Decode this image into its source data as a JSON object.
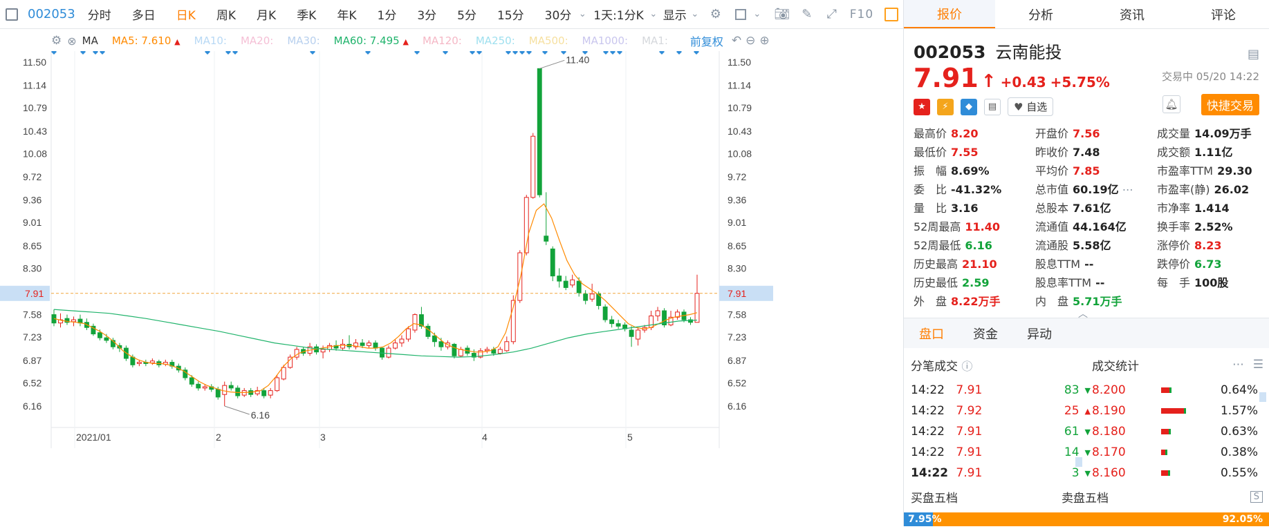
{
  "toolbar": {
    "code": "002053",
    "periods": [
      "分时",
      "多日",
      "日K",
      "周K",
      "月K",
      "季K",
      "年K",
      "1分",
      "3分",
      "5分",
      "15分",
      "30分"
    ],
    "active_period": "日K",
    "combo": "1天:1分K",
    "display": "显示",
    "f10": "F10"
  },
  "ma_bar": {
    "ma_label": "MA",
    "ma5": "MA5: 7.610",
    "ma10": "MA10:",
    "ma20": "MA20:",
    "ma30": "MA30:",
    "ma60": "MA60: 7.495",
    "ma120": "MA120:",
    "ma250": "MA250:",
    "ma500": "MA500:",
    "ma1000": "MA1000:",
    "ma1": "MA1:",
    "adjust": "前复权"
  },
  "colors": {
    "up": "#e5211c",
    "down": "#12a33a",
    "ma5": "#ff8a00",
    "ma60": "#1fb36b",
    "accent": "#ff7e00",
    "blue": "#2f8cd8"
  },
  "chart_data": {
    "type": "candlestick",
    "y_ticks": [
      "11.50",
      "11.14",
      "10.79",
      "10.43",
      "10.08",
      "9.72",
      "9.36",
      "9.01",
      "8.65",
      "8.30",
      "7.91",
      "7.58",
      "7.23",
      "6.87",
      "6.52",
      "6.16"
    ],
    "x_ticks": [
      "2021/01",
      "2",
      "3",
      "4",
      "5"
    ],
    "current_price": "7.91",
    "high_label": "11.40",
    "low_label": "6.16",
    "ylim": [
      5.9,
      11.75
    ],
    "candles": [
      [
        7.58,
        7.45,
        7.66,
        7.4
      ],
      [
        7.45,
        7.5,
        7.6,
        7.38
      ],
      [
        7.52,
        7.46,
        7.58,
        7.42
      ],
      [
        7.47,
        7.5,
        7.55,
        7.4
      ],
      [
        7.51,
        7.45,
        7.58,
        7.4
      ],
      [
        7.46,
        7.38,
        7.52,
        7.34
      ],
      [
        7.4,
        7.28,
        7.44,
        7.25
      ],
      [
        7.3,
        7.22,
        7.35,
        7.18
      ],
      [
        7.22,
        7.18,
        7.28,
        7.14
      ],
      [
        7.18,
        7.08,
        7.22,
        7.04
      ],
      [
        7.1,
        7.06,
        7.14,
        7.0
      ],
      [
        7.06,
        6.9,
        7.1,
        6.86
      ],
      [
        6.92,
        6.8,
        6.96,
        6.76
      ],
      [
        6.82,
        6.84,
        6.88,
        6.78
      ],
      [
        6.84,
        6.82,
        6.88,
        6.78
      ],
      [
        6.83,
        6.86,
        6.9,
        6.8
      ],
      [
        6.85,
        6.8,
        6.88,
        6.76
      ],
      [
        6.81,
        6.84,
        6.88,
        6.78
      ],
      [
        6.84,
        6.78,
        6.88,
        6.74
      ],
      [
        6.78,
        6.72,
        6.82,
        6.68
      ],
      [
        6.72,
        6.6,
        6.76,
        6.56
      ],
      [
        6.6,
        6.5,
        6.64,
        6.46
      ],
      [
        6.5,
        6.44,
        6.54,
        6.4
      ],
      [
        6.44,
        6.46,
        6.5,
        6.4
      ],
      [
        6.46,
        6.42,
        6.5,
        6.38
      ],
      [
        6.42,
        6.3,
        6.46,
        6.26
      ],
      [
        6.34,
        6.48,
        6.54,
        6.16
      ],
      [
        6.48,
        6.44,
        6.54,
        6.4
      ],
      [
        6.44,
        6.32,
        6.48,
        6.28
      ],
      [
        6.33,
        6.4,
        6.44,
        6.3
      ],
      [
        6.4,
        6.34,
        6.44,
        6.3
      ],
      [
        6.35,
        6.4,
        6.46,
        6.32
      ],
      [
        6.4,
        6.32,
        6.44,
        6.28
      ],
      [
        6.33,
        6.4,
        6.44,
        6.28
      ],
      [
        6.4,
        6.6,
        6.64,
        6.38
      ],
      [
        6.58,
        6.76,
        6.8,
        6.56
      ],
      [
        6.76,
        6.92,
        6.96,
        6.74
      ],
      [
        6.92,
        7.04,
        7.08,
        6.88
      ],
      [
        7.04,
        6.98,
        7.08,
        6.94
      ],
      [
        6.98,
        7.08,
        7.14,
        6.94
      ],
      [
        7.08,
        7.0,
        7.12,
        6.96
      ],
      [
        7.0,
        7.04,
        7.1,
        6.9
      ],
      [
        7.04,
        7.1,
        7.14,
        7.0
      ],
      [
        7.1,
        7.06,
        7.18,
        7.02
      ],
      [
        7.06,
        7.12,
        7.2,
        7.02
      ],
      [
        7.12,
        7.08,
        7.26,
        7.04
      ],
      [
        7.08,
        7.14,
        7.2,
        7.04
      ],
      [
        7.14,
        7.1,
        7.2,
        7.06
      ],
      [
        7.1,
        7.14,
        7.18,
        7.06
      ],
      [
        7.14,
        7.06,
        7.18,
        7.02
      ],
      [
        7.06,
        6.92,
        7.08,
        6.88
      ],
      [
        6.92,
        7.06,
        7.1,
        6.9
      ],
      [
        7.06,
        7.14,
        7.2,
        7.04
      ],
      [
        7.14,
        7.2,
        7.26,
        7.08
      ],
      [
        7.2,
        7.36,
        7.4,
        7.16
      ],
      [
        7.34,
        7.58,
        7.6,
        7.3
      ],
      [
        7.58,
        7.4,
        7.7,
        7.36
      ],
      [
        7.4,
        7.24,
        7.44,
        7.2
      ],
      [
        7.25,
        7.16,
        7.3,
        7.08
      ],
      [
        7.16,
        7.08,
        7.22,
        7.02
      ],
      [
        7.08,
        7.14,
        7.18,
        7.04
      ],
      [
        7.12,
        6.94,
        7.14,
        6.9
      ],
      [
        6.94,
        7.04,
        7.08,
        6.92
      ],
      [
        7.06,
        6.98,
        7.1,
        6.94
      ],
      [
        6.98,
        6.92,
        7.04,
        6.86
      ],
      [
        6.92,
        7.02,
        7.06,
        6.9
      ],
      [
        7.02,
        7.04,
        7.08,
        6.98
      ],
      [
        7.04,
        6.98,
        7.08,
        6.94
      ],
      [
        6.98,
        7.04,
        7.08,
        6.96
      ],
      [
        7.02,
        7.16,
        7.24,
        7.0
      ],
      [
        7.16,
        7.8,
        7.88,
        7.12
      ],
      [
        7.8,
        8.54,
        8.58,
        7.76
      ],
      [
        8.54,
        9.4,
        9.44,
        8.5
      ],
      [
        9.4,
        10.35,
        10.4,
        9.38
      ],
      [
        11.4,
        9.44,
        11.4,
        9.4
      ],
      [
        8.8,
        8.72,
        9.48,
        8.66
      ],
      [
        8.6,
        8.18,
        8.64,
        8.1
      ],
      [
        8.18,
        8.1,
        8.3,
        8.0
      ],
      [
        8.1,
        8.0,
        8.18,
        7.96
      ],
      [
        8.04,
        8.12,
        8.2,
        8.0
      ],
      [
        8.1,
        7.92,
        8.16,
        7.86
      ],
      [
        7.9,
        7.8,
        7.96,
        7.74
      ],
      [
        7.82,
        7.9,
        8.06,
        7.78
      ],
      [
        7.9,
        7.72,
        7.94,
        7.66
      ],
      [
        7.7,
        7.5,
        7.74,
        7.46
      ],
      [
        7.5,
        7.44,
        7.56,
        7.38
      ],
      [
        7.44,
        7.4,
        7.5,
        7.36
      ],
      [
        7.42,
        7.36,
        7.46,
        7.32
      ],
      [
        7.34,
        7.24,
        7.4,
        7.08
      ],
      [
        7.2,
        7.34,
        7.38,
        7.1
      ],
      [
        7.34,
        7.38,
        7.42,
        7.3
      ],
      [
        7.38,
        7.56,
        7.64,
        7.34
      ],
      [
        7.56,
        7.64,
        7.7,
        7.48
      ],
      [
        7.64,
        7.42,
        7.68,
        7.38
      ],
      [
        7.42,
        7.54,
        7.64,
        7.4
      ],
      [
        7.54,
        7.62,
        7.66,
        7.5
      ],
      [
        7.62,
        7.5,
        7.66,
        7.46
      ],
      [
        7.5,
        7.46,
        7.54,
        7.42
      ],
      [
        7.46,
        7.91,
        8.2,
        7.55
      ]
    ],
    "ma5": [
      7.52,
      7.49,
      7.47,
      7.46,
      7.44,
      7.38,
      7.32,
      7.24,
      7.14,
      7.02,
      6.94,
      6.88,
      6.84,
      6.82,
      6.82,
      6.8,
      6.76,
      6.7,
      6.62,
      6.54,
      6.48,
      6.44,
      6.4,
      6.38,
      6.37,
      6.37,
      6.38,
      6.4,
      6.48,
      6.62,
      6.78,
      6.9,
      6.98,
      7.02,
      7.04,
      7.06,
      7.08,
      7.1,
      7.1,
      7.1,
      7.08,
      7.06,
      7.06,
      7.08,
      7.14,
      7.24,
      7.36,
      7.44,
      7.42,
      7.34,
      7.24,
      7.14,
      7.08,
      7.04,
      7.02,
      7.0,
      7.0,
      7.02,
      7.08,
      7.3,
      7.7,
      8.2,
      8.84,
      9.2,
      9.3,
      9.08,
      8.74,
      8.42,
      8.2,
      8.06,
      7.98,
      7.9,
      7.8,
      7.68,
      7.56,
      7.44,
      7.38,
      7.36,
      7.38,
      7.44,
      7.5,
      7.54,
      7.56,
      7.58,
      7.61
    ],
    "ma60": [
      7.66,
      7.64,
      7.62,
      7.6,
      7.56,
      7.52,
      7.47,
      7.42,
      7.37,
      7.32,
      7.26,
      7.2,
      7.14,
      7.1,
      7.06,
      7.04,
      7.02,
      7.0,
      6.98,
      6.96,
      6.94,
      6.93,
      6.92,
      6.93,
      6.96,
      7.0,
      7.06,
      7.14,
      7.22,
      7.28,
      7.32,
      7.36,
      7.4,
      7.44,
      7.48,
      7.495
    ]
  },
  "quote": {
    "code": "002053",
    "name": "云南能投",
    "price": "7.91",
    "arrow": "↑",
    "change": "+0.43",
    "change_pct": "+5.75%",
    "status": "交易中 05/20 14:22",
    "zixuan": "自选",
    "fast_trade": "快捷交易"
  },
  "right_tabs": [
    "报价",
    "分析",
    "资讯",
    "评论"
  ],
  "metrics": [
    {
      "label": "最高价",
      "value": "8.20",
      "color": "red"
    },
    {
      "label": "开盘价",
      "value": "7.56",
      "color": "red"
    },
    {
      "label": "成交量",
      "value": "14.09万手",
      "color": "dark"
    },
    {
      "label": "最低价",
      "value": "7.55",
      "color": "red"
    },
    {
      "label": "昨收价",
      "value": "7.48",
      "color": "dark"
    },
    {
      "label": "成交额",
      "value": "1.11亿",
      "color": "dark"
    },
    {
      "label": "振　幅",
      "value": "8.69%",
      "color": "dark"
    },
    {
      "label": "平均价",
      "value": "7.85",
      "color": "red"
    },
    {
      "label": "市盈率TTM",
      "value": "29.30",
      "color": "dark"
    },
    {
      "label": "委　比",
      "value": "-41.32%",
      "color": "dark"
    },
    {
      "label": "总市值",
      "value": "60.19亿",
      "color": "dark"
    },
    {
      "label": "市盈率(静)",
      "value": "26.02",
      "color": "dark"
    },
    {
      "label": "量　比",
      "value": "3.16",
      "color": "dark"
    },
    {
      "label": "总股本",
      "value": "7.61亿",
      "color": "dark"
    },
    {
      "label": "市净率",
      "value": "1.414",
      "color": "dark"
    },
    {
      "label": "52周最高",
      "value": "11.40",
      "color": "red"
    },
    {
      "label": "流通值",
      "value": "44.164亿",
      "color": "dark"
    },
    {
      "label": "换手率",
      "value": "2.52%",
      "color": "dark"
    },
    {
      "label": "52周最低",
      "value": "6.16",
      "color": "green"
    },
    {
      "label": "流通股",
      "value": "5.58亿",
      "color": "dark"
    },
    {
      "label": "涨停价",
      "value": "8.23",
      "color": "red"
    },
    {
      "label": "历史最高",
      "value": "21.10",
      "color": "red"
    },
    {
      "label": "股息TTM",
      "value": "--",
      "color": "dark"
    },
    {
      "label": "跌停价",
      "value": "6.73",
      "color": "green"
    },
    {
      "label": "历史最低",
      "value": "2.59",
      "color": "green"
    },
    {
      "label": "股息率TTM",
      "value": "--",
      "color": "dark"
    },
    {
      "label": "每　手",
      "value": "100股",
      "color": "dark"
    },
    {
      "label": "外　盘",
      "value": "8.22万手",
      "color": "red"
    },
    {
      "label": "内　盘",
      "value": "5.71万手",
      "color": "green"
    },
    {
      "label": "",
      "value": "",
      "color": "dark"
    }
  ],
  "section_tabs": [
    "盘口",
    "资金",
    "异动"
  ],
  "trades_title": "分笔成交",
  "stats_title": "成交统计",
  "trades": [
    {
      "time": "14:22",
      "price": "7.91",
      "vol": "83",
      "dir": "down"
    },
    {
      "time": "14:22",
      "price": "7.92",
      "vol": "25",
      "dir": "up"
    },
    {
      "time": "14:22",
      "price": "7.91",
      "vol": "61",
      "dir": "down"
    },
    {
      "time": "14:22",
      "price": "7.91",
      "vol": "14",
      "dir": "down"
    },
    {
      "time": "14:22",
      "price": "7.91",
      "vol": "3",
      "dir": "down"
    }
  ],
  "stats": [
    {
      "price": "8.200",
      "pct": "0.64%",
      "share": 0.64
    },
    {
      "price": "8.190",
      "pct": "1.57%",
      "share": 1.57
    },
    {
      "price": "8.180",
      "pct": "0.63%",
      "share": 0.63
    },
    {
      "price": "8.170",
      "pct": "0.38%",
      "share": 0.38
    },
    {
      "price": "8.160",
      "pct": "0.55%",
      "share": 0.55
    }
  ],
  "bid_label": "买盘五档",
  "ask_label": "卖盘五档",
  "bid_pct": "7.95%",
  "ask_pct": "92.05%",
  "bid_share": 0.0795
}
